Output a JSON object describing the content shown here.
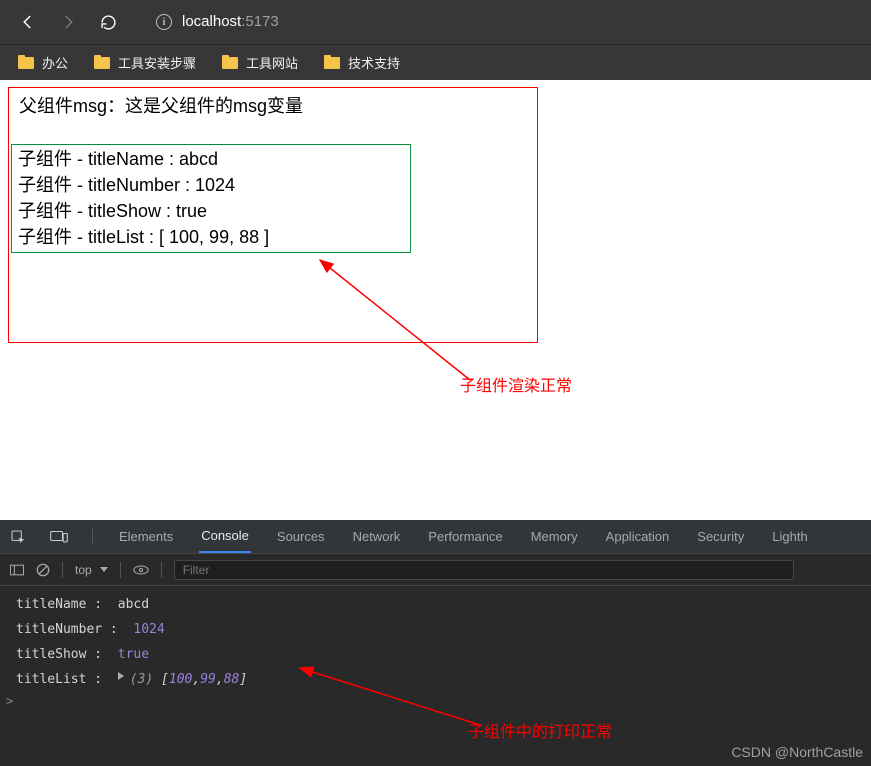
{
  "browser": {
    "url_host": "localhost",
    "url_port": ":5173"
  },
  "bookmarks": [
    "办公",
    "工具安装步骤",
    "工具网站",
    "技术支持"
  ],
  "page": {
    "parent_line": "父组件msg：这是父组件的msg变量",
    "child_lines": [
      "子组件 - titleName : abcd",
      "子组件 - titleNumber : 1024",
      "子组件 - titleShow : true",
      "子组件 - titleList : [ 100, 99, 88 ]"
    ]
  },
  "annotations": {
    "a1": "子组件渲染正常",
    "a2": "子组件中的打印正常"
  },
  "devtools": {
    "tabs": [
      "Elements",
      "Console",
      "Sources",
      "Network",
      "Performance",
      "Memory",
      "Application",
      "Security",
      "Lighth"
    ],
    "active_tab": "Console",
    "context": "top",
    "filter_placeholder": "Filter",
    "console": [
      {
        "label": "titleName :  ",
        "type": "str",
        "value": "abcd"
      },
      {
        "label": "titleNumber :  ",
        "type": "num",
        "value": "1024"
      },
      {
        "label": "titleShow :  ",
        "type": "bool",
        "value": "true"
      },
      {
        "label": "titleList :  ",
        "type": "arr",
        "count": "(3)",
        "values": [
          "100",
          "99",
          "88"
        ]
      }
    ]
  },
  "watermark": "CSDN @NorthCastle"
}
